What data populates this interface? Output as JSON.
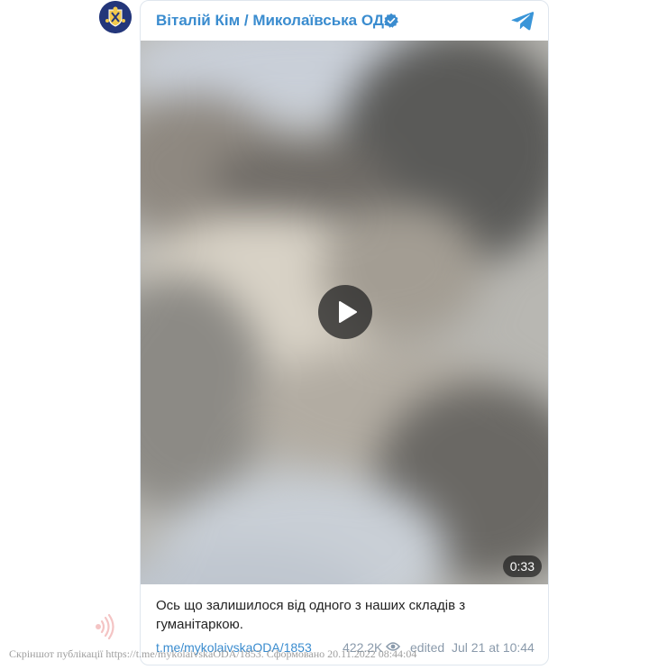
{
  "channel": {
    "name": "Віталій Кім / Миколаївська ОДА",
    "verified": true,
    "avatar_icon": "coat-of-arms-icon",
    "brand_icon": "telegram-logo-icon",
    "name_color": "#3a8ccf"
  },
  "video": {
    "duration": "0:33",
    "play_icon": "play-icon",
    "blurred": true
  },
  "caption": "Ось що залишилося від одного з наших складів з гуманітаркою.",
  "footer": {
    "link_text": "t.me/mykolaivskaODA/1853",
    "views": "422.2K",
    "views_icon": "eye-icon",
    "edited_label": "edited",
    "timestamp": "Jul 21 at 10:44"
  },
  "watermark": {
    "text": "Скріншот публікації https://t.me/mykolaivskaODA/1853. Сформовано 20.11.2022 08:44:04",
    "icon": "sound-waves-logo-icon"
  }
}
